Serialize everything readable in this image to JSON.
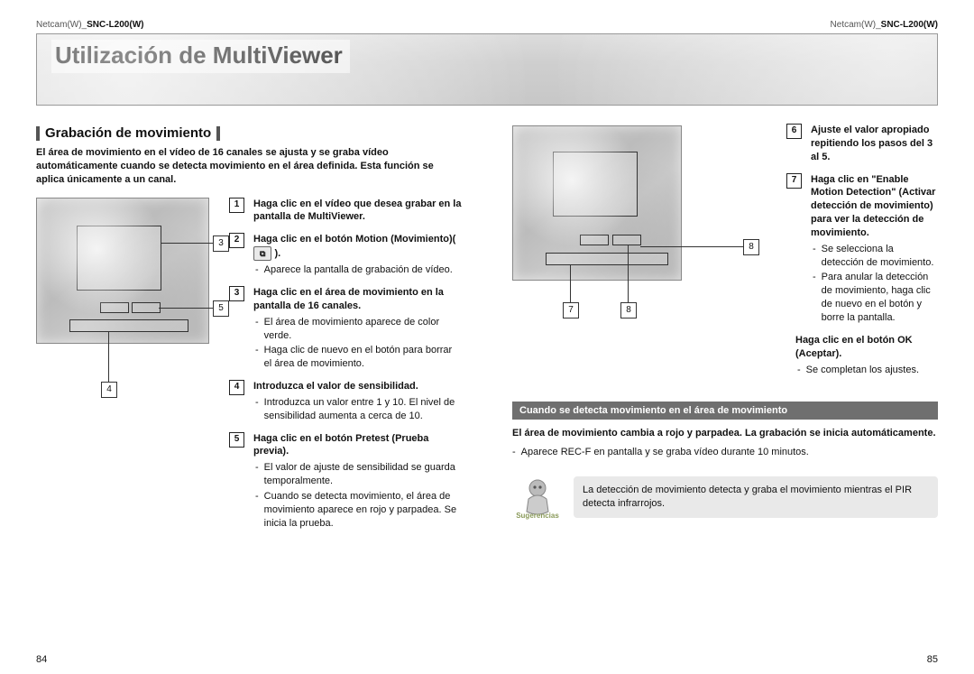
{
  "header": {
    "product_left": "Netcam(W)_",
    "product_model": "SNC-L200(W)",
    "banner_title": "Utilización de MultiViewer"
  },
  "left": {
    "section_title": "Grabación de movimiento",
    "intro": "El área de movimiento en el vídeo de 16 canales se ajusta y se graba vídeo automáticamente cuando se detecta movimiento en el área definida. Esta función se aplica únicamente a un canal.",
    "steps": [
      {
        "n": "1",
        "title": "Haga clic en el vídeo que desea grabar en la pantalla de MultiViewer."
      },
      {
        "n": "2",
        "title_pre": "Haga clic en el botón Motion (Movimiento)(",
        "title_post": ").",
        "subs": [
          "Aparece la pantalla de grabación de vídeo."
        ]
      },
      {
        "n": "3",
        "title": "Haga clic en el área de movimiento en la pantalla de 16 canales.",
        "subs": [
          "El área de movimiento aparece de color verde.",
          "Haga clic de nuevo en el botón para borrar el área de movimiento."
        ]
      },
      {
        "n": "4",
        "title": "Introduzca el valor de sensibilidad.",
        "subs": [
          "Introduzca un valor entre 1 y 10. El nivel de sensibilidad aumenta a cerca de 10."
        ]
      },
      {
        "n": "5",
        "title": "Haga clic en el botón Pretest (Prueba previa).",
        "subs": [
          "El valor de ajuste de sensibilidad se guarda temporalmente.",
          "Cuando se detecta movimiento, el área de movimiento aparece en rojo y parpadea. Se inicia la prueba."
        ]
      }
    ],
    "callouts": {
      "c3": "3",
      "c5": "5",
      "c4": "4"
    }
  },
  "right": {
    "steps": [
      {
        "n": "6",
        "title": "Ajuste el valor apropiado repitiendo los pasos del 3 al 5."
      },
      {
        "n": "7",
        "title": "Haga clic en \"Enable Motion Detection\" (Activar detección de movimiento) para ver la detección de movimiento.",
        "subs": [
          "Se selecciona la detección de movimiento.",
          "Para anular la detección de movimiento, haga clic de nuevo en el botón y borre la pantalla."
        ]
      },
      {
        "n": "8",
        "title_only": "Haga clic en el botón OK (Aceptar).",
        "subs": [
          "Se completan los ajustes."
        ]
      }
    ],
    "callouts": {
      "c7": "7",
      "c8": "8",
      "c8b": "8"
    },
    "sub_banner": "Cuando se detecta movimiento en el área de movimiento",
    "para_bold": "El área de movimiento cambia a rojo y parpadea. La grabación se inicia automáticamente.",
    "para_sub": "Aparece REC-F en pantalla y se graba vídeo durante 10 minutos.",
    "tip_label": "Sugerencias",
    "tip_text": "La detección de movimiento detecta y graba el movimiento mientras el PIR detecta infrarrojos."
  },
  "page_left": "84",
  "page_right": "85"
}
